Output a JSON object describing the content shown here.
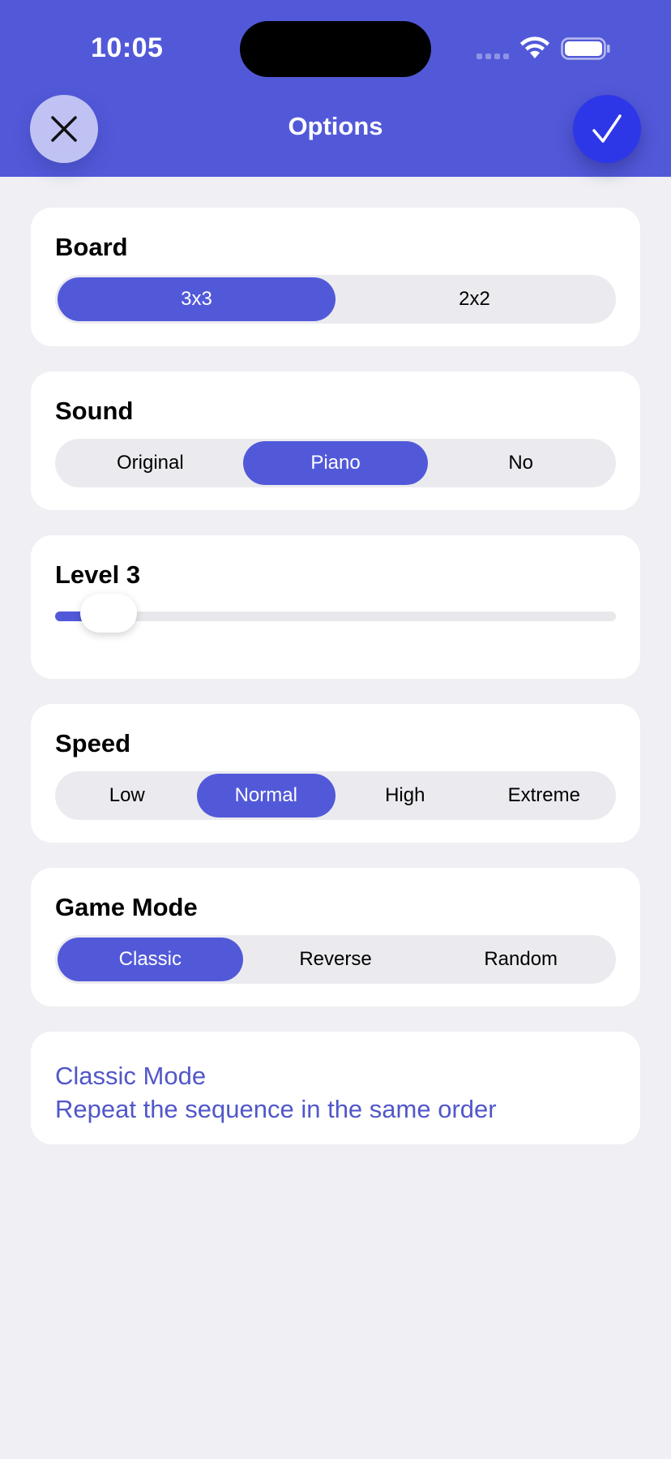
{
  "status_bar": {
    "time": "10:05"
  },
  "header": {
    "title": "Options"
  },
  "icons": {
    "close": "close-icon",
    "confirm": "checkmark-icon",
    "wifi": "wifi-icon",
    "battery": "battery-icon"
  },
  "colors": {
    "accent": "#5259d9",
    "confirm": "#2d37e8",
    "close_bg": "#c0c2f3",
    "background": "#efeff4",
    "desc_text": "#5157c9"
  },
  "board": {
    "label": "Board",
    "options": [
      "3x3",
      "2x2"
    ],
    "selected": "3x3"
  },
  "sound": {
    "label": "Sound",
    "options": [
      "Original",
      "Piano",
      "No"
    ],
    "selected": "Piano"
  },
  "level": {
    "label": "Level 3",
    "value": 3
  },
  "speed": {
    "label": "Speed",
    "options": [
      "Low",
      "Normal",
      "High",
      "Extreme"
    ],
    "selected": "Normal"
  },
  "game_mode": {
    "label": "Game Mode",
    "options": [
      "Classic",
      "Reverse",
      "Random"
    ],
    "selected": "Classic"
  },
  "description": {
    "title": "Classic Mode",
    "text": "Repeat the sequence in the same order"
  }
}
